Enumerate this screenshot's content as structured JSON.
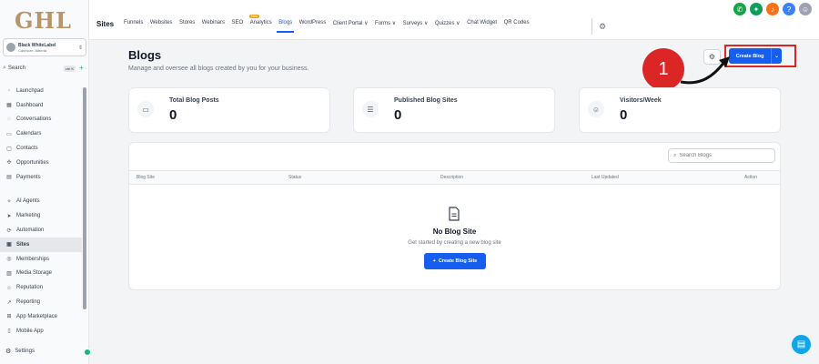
{
  "sidebar": {
    "logo": "GHL",
    "account": {
      "name": "Black WhiteLabel",
      "location": "Canmore, Alberta"
    },
    "search": {
      "label": "Search",
      "shortcut": "ctrl K"
    },
    "items": [
      {
        "label": "Launchpad",
        "icon": "rocket-icon"
      },
      {
        "label": "Dashboard",
        "icon": "dashboard-icon"
      },
      {
        "label": "Conversations",
        "icon": "chat-icon"
      },
      {
        "label": "Calendars",
        "icon": "calendar-icon"
      },
      {
        "label": "Contacts",
        "icon": "contacts-icon"
      },
      {
        "label": "Opportunities",
        "icon": "opportunities-icon"
      },
      {
        "label": "Payments",
        "icon": "payments-icon"
      },
      {
        "label": "AI Agents",
        "icon": "ai-icon"
      },
      {
        "label": "Marketing",
        "icon": "marketing-icon"
      },
      {
        "label": "Automation",
        "icon": "automation-icon"
      },
      {
        "label": "Sites",
        "icon": "sites-icon",
        "active": true
      },
      {
        "label": "Memberships",
        "icon": "memberships-icon"
      },
      {
        "label": "Media Storage",
        "icon": "media-icon"
      },
      {
        "label": "Reputation",
        "icon": "reputation-icon"
      },
      {
        "label": "Reporting",
        "icon": "reporting-icon"
      },
      {
        "label": "App Marketplace",
        "icon": "marketplace-icon"
      },
      {
        "label": "Mobile App",
        "icon": "mobile-icon"
      }
    ],
    "settings": "Settings"
  },
  "topbar": {
    "section": "Sites",
    "tabs": [
      "Funnels",
      "Websites",
      "Stores",
      "Webinars",
      "SEO",
      "Analytics",
      "Blogs",
      "WordPress",
      "Client Portal ∨",
      "Forms ∨",
      "Surveys ∨",
      "Quizzes ∨",
      "Chat Widget",
      "QR Codes"
    ],
    "active_tab": "Blogs",
    "new_badge": "New",
    "colors": {
      "phone": "#16a34a",
      "megaphone": "#0f9d58",
      "bell": "#f97316",
      "help": "#3b82f6"
    }
  },
  "page": {
    "title": "Blogs",
    "subtitle": "Manage and oversee all blogs created by you for your business.",
    "create_button": "Create Blog",
    "callout": "1"
  },
  "stats": [
    {
      "label": "Total Blog Posts",
      "value": "0",
      "icon": "calendar-icon"
    },
    {
      "label": "Published Blog Sites",
      "value": "0",
      "icon": "list-icon"
    },
    {
      "label": "Visitors/Week",
      "value": "0",
      "icon": "users-icon"
    }
  ],
  "table": {
    "search_placeholder": "Search Blogs",
    "columns": [
      "Blog Site",
      "Status",
      "Description",
      "Last Updated",
      "Action"
    ],
    "empty_title": "No Blog Site",
    "empty_sub": "Get started by creating a new blog site",
    "create_site_button": "Create Blog Site"
  },
  "accent_color": "#155eef"
}
